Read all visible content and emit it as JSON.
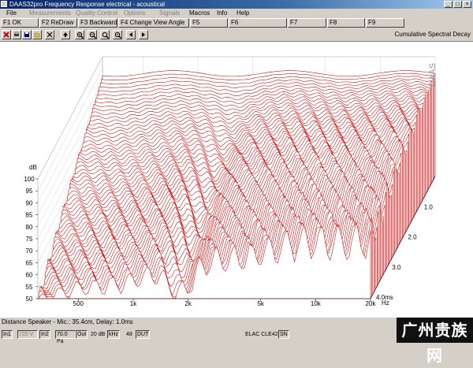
{
  "window": {
    "title": "DAAS32pro Frequency Response electrical - acoustical"
  },
  "menu": [
    "File",
    "Measurements",
    "Quality Control",
    "Options",
    "Signals",
    "Macros",
    "Info",
    "Help"
  ],
  "menu_disabled": [
    false,
    true,
    true,
    true,
    true,
    false,
    false,
    false
  ],
  "fkeys": [
    {
      "label": "F1 OK"
    },
    {
      "label": "F2 ReDraw"
    },
    {
      "label": "F3 Backward"
    },
    {
      "label": "F4 Change View Angle"
    },
    {
      "label": "F5"
    },
    {
      "label": "F6"
    },
    {
      "label": "F7"
    },
    {
      "label": "F8"
    },
    {
      "label": "F9"
    }
  ],
  "toolbar": {
    "icons": [
      "close-icon",
      "print-icon",
      "disk-icon",
      "open-folder-icon",
      "x-icon",
      "up-arrow-icon",
      "zoom-in-icon",
      "zoom-out-icon",
      "zoom-fit-icon",
      "zoom-reset-icon",
      "prev-icon",
      "next-icon"
    ],
    "view_label": "Cumulative Spectral Decay"
  },
  "chart_data": {
    "type": "area",
    "title": "Cumulative Spectral Decay",
    "ylabel": "dB",
    "xlabel": "Hz",
    "zlabel": "ms",
    "y_ticks": [
      100,
      95,
      90,
      85,
      80,
      75,
      70,
      65,
      60,
      55,
      50
    ],
    "ylim": [
      50,
      100
    ],
    "x_ticks": [
      "500",
      "1k",
      "2k",
      "5k",
      "10k",
      "20k"
    ],
    "x_scale": "log",
    "x_range_hz": [
      300,
      20000
    ],
    "time_ticks": [
      "1.0",
      "2.0",
      "3.0",
      "4.0ms"
    ],
    "time_range_ms": [
      0,
      4.0
    ],
    "series_count": 60,
    "series_color": "#cc0000",
    "background": "#ffffff",
    "watermark_corner": "DAAS"
  },
  "status": {
    "line1": "Distance Speaker - Mic.: 35.4cm, Delay: 1.0ms",
    "in1": "In1",
    "volt": "720 V",
    "in2": "In2",
    "level": "70.0 Pa",
    "out": "Out",
    "gain": "20 dB",
    "khz": "kHz",
    "rate": "48",
    "dut": "DUT",
    "device": "ELAC CLE42",
    "sn": "SN"
  },
  "watermark": "广州贵族网"
}
